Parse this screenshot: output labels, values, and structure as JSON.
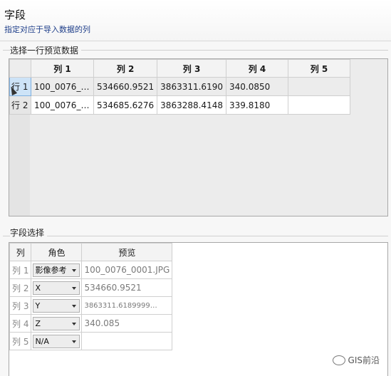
{
  "header": {
    "title": "字段",
    "subtitle": "指定对应于导入数据的列"
  },
  "preview": {
    "group_label": "选择一行预览数据",
    "columns": [
      "列 1",
      "列 2",
      "列 3",
      "列 4",
      "列 5"
    ],
    "rows": [
      {
        "header": "行 1",
        "cells": [
          "100_0076_0…",
          "534660.9521",
          "3863311.6190",
          "340.0850",
          ""
        ]
      },
      {
        "header": "行 2",
        "cells": [
          "100_0076_0…",
          "534685.6276",
          "3863288.4148",
          "339.8180",
          ""
        ]
      }
    ]
  },
  "fields": {
    "group_label": "字段选择",
    "headers": {
      "col": "列",
      "role": "角色",
      "preview": "预览"
    },
    "rows": [
      {
        "col": "列 1",
        "role": "影像参考",
        "preview": "100_0076_0001.JPG"
      },
      {
        "col": "列 2",
        "role": "X",
        "preview": "534660.9521"
      },
      {
        "col": "列 3",
        "role": "Y",
        "preview": "3863311.6189999…"
      },
      {
        "col": "列 4",
        "role": "Z",
        "preview": "340.085"
      },
      {
        "col": "列 5",
        "role": "N/A",
        "preview": ""
      }
    ]
  },
  "watermark": "GIS前沿"
}
